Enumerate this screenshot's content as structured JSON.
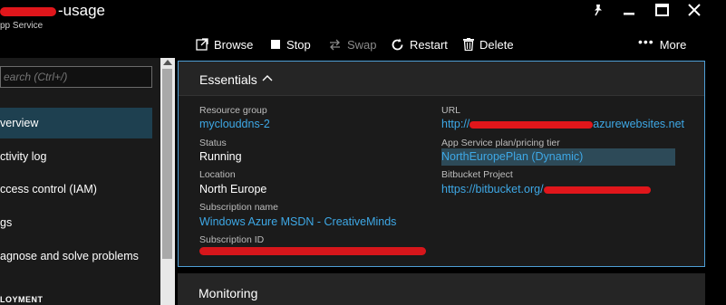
{
  "window": {
    "title": "-usage",
    "subtitle": "pp Service"
  },
  "toolbar": {
    "browse": "Browse",
    "stop": "Stop",
    "swap": "Swap",
    "restart": "Restart",
    "delete": "Delete",
    "more": "More"
  },
  "sidebar": {
    "search_placeholder": "earch (Ctrl+/)",
    "items": [
      {
        "label": "verview",
        "active": true
      },
      {
        "label": "ctivity log"
      },
      {
        "label": "ccess control (IAM)"
      },
      {
        "label": "gs"
      },
      {
        "label": "agnose and solve problems"
      }
    ],
    "section_label": "LOYMENT"
  },
  "essentials": {
    "title": "Essentials",
    "left": [
      {
        "label": "Resource group",
        "value": "myclouddns-2",
        "link": true
      },
      {
        "label": "Status",
        "value": "Running"
      },
      {
        "label": "Location",
        "value": "North Europe"
      },
      {
        "label": "Subscription name",
        "value": "Windows Azure MSDN - CreativeMinds",
        "link": true
      },
      {
        "label": "Subscription ID",
        "value": ""
      }
    ],
    "right": [
      {
        "label": "URL",
        "value": "http://",
        "value_suffix": "azurewebsites.net"
      },
      {
        "label": "App Service plan/pricing tier",
        "value": "NorthEuropePlan (Dynamic)"
      },
      {
        "label": "Bitbucket Project",
        "value": "https://bitbucket.org/"
      }
    ]
  },
  "monitoring": {
    "title": "Monitoring"
  },
  "colors": {
    "accent": "#4f9fd6",
    "link": "#3ea8e6",
    "active_nav": "#1e4050",
    "redaction": "#e0161b"
  }
}
